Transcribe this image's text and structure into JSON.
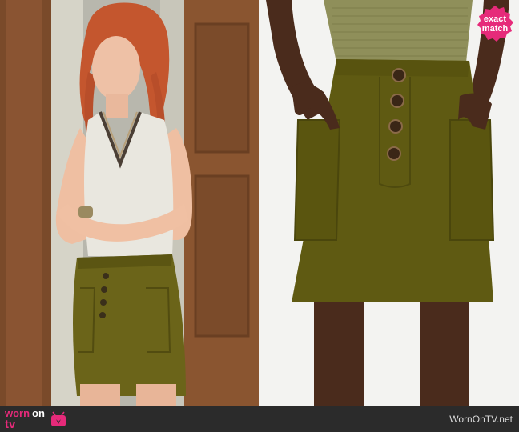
{
  "badge": {
    "line1": "exact",
    "line2": "match",
    "color": "#e62a7a"
  },
  "footer": {
    "logo_word1": "worn",
    "logo_word2": "on",
    "logo_word3": "tv",
    "logo_icon": "tv-icon",
    "site_name": "WornOnTV.net",
    "background": "#2b2b2b",
    "accent": "#e62a7a"
  },
  "photos": {
    "left": {
      "subject": "woman in white knit tank and olive corduroy mini skirt, arms crossed"
    },
    "right": {
      "subject": "product shot of olive corduroy button-front mini skirt with patch pockets"
    }
  },
  "colors": {
    "skirt": "#5f5a12",
    "top_right": "#8f8f5a",
    "background_right": "#f3f3f1"
  }
}
